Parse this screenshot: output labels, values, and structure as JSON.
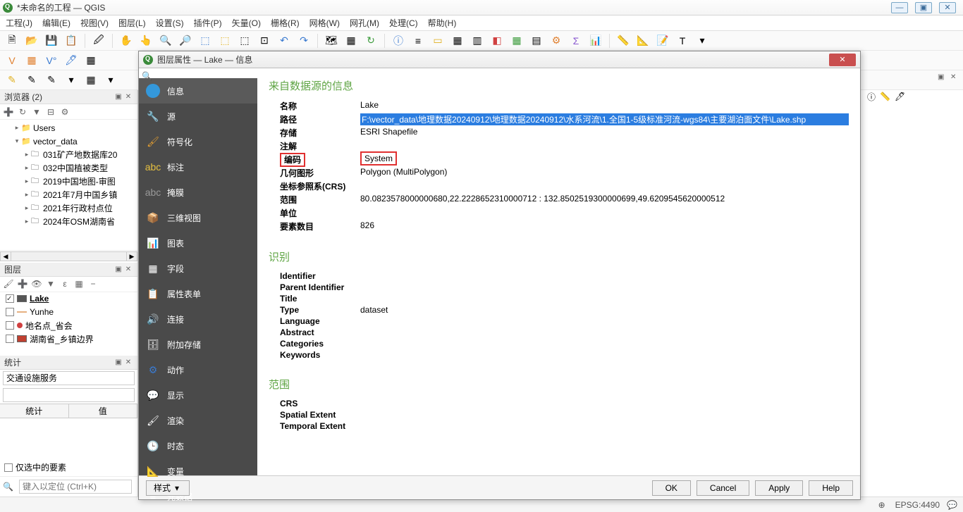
{
  "window": {
    "title": "*未命名的工程 — QGIS"
  },
  "menus": [
    "工程(J)",
    "编辑(E)",
    "视图(V)",
    "图层(L)",
    "设置(S)",
    "插件(P)",
    "矢量(O)",
    "栅格(R)",
    "网格(W)",
    "网孔(M)",
    "处理(C)",
    "帮助(H)"
  ],
  "browser": {
    "title": "浏览器 (2)",
    "items": [
      {
        "indent": 1,
        "exp": "▸",
        "icon": "📁",
        "label": "Users"
      },
      {
        "indent": 1,
        "exp": "▾",
        "icon": "📁",
        "label": "vector_data"
      },
      {
        "indent": 2,
        "exp": "▸",
        "icon": "🗀",
        "label": "031矿产地数据库20"
      },
      {
        "indent": 2,
        "exp": "▸",
        "icon": "🗀",
        "label": "032中国植被类型"
      },
      {
        "indent": 2,
        "exp": "▸",
        "icon": "🗀",
        "label": "2019中国地图-审图"
      },
      {
        "indent": 2,
        "exp": "▸",
        "icon": "🗀",
        "label": "2021年7月中国乡镇"
      },
      {
        "indent": 2,
        "exp": "▸",
        "icon": "🗀",
        "label": "2021年行政村点位"
      },
      {
        "indent": 2,
        "exp": "▸",
        "icon": "🗀",
        "label": "2024年OSM湖南省"
      }
    ]
  },
  "layers": {
    "title": "图层",
    "items": [
      {
        "checked": true,
        "color": "#555",
        "label": "Lake",
        "bold": true
      },
      {
        "checked": false,
        "color": "#e6b080",
        "label": "Yunhe",
        "line": true
      },
      {
        "checked": false,
        "color": "#d04040",
        "label": "地名点_省会",
        "dot": true
      },
      {
        "checked": false,
        "color": "#c04030",
        "label": "湖南省_乡镇边界"
      }
    ]
  },
  "stats": {
    "title": "统计",
    "service": "交通设施服务",
    "th1": "统计",
    "th2": "值",
    "cb_label": "仅选中的要素",
    "search_placeholder": "键入以定位 (Ctrl+K)"
  },
  "dialog": {
    "title": "图层属性 — Lake — 信息",
    "sidebar": [
      "信息",
      "源",
      "符号化",
      "标注",
      "掩膜",
      "三维视图",
      "图表",
      "字段",
      "属性表单",
      "连接",
      "附加存储",
      "动作",
      "显示",
      "渲染",
      "时态",
      "变量",
      "元数据"
    ],
    "section1": "来自数据源的信息",
    "rows1": [
      {
        "k": "名称",
        "v": "Lake"
      },
      {
        "k": "路径",
        "v": "F:\\vector_data\\地理数据20240912\\地理数据20240912\\水系河流\\1.全国1-5级标准河流-wgs84\\主要湖泊面文件\\Lake.shp",
        "sel": true
      },
      {
        "k": "存储",
        "v": "ESRI Shapefile"
      },
      {
        "k": "注解",
        "v": ""
      },
      {
        "k": "编码",
        "v": "System",
        "red": true
      },
      {
        "k": "几何图形",
        "v": "Polygon (MultiPolygon)"
      },
      {
        "k": "坐标参照系(CRS)",
        "v": ""
      },
      {
        "k": "范围",
        "v": "80.0823578000000680,22.2228652310000712 : 132.8502519300000699,49.6209545620000512"
      },
      {
        "k": "单位",
        "v": ""
      },
      {
        "k": "要素数目",
        "v": "826"
      }
    ],
    "section2": "识别",
    "rows2": [
      {
        "k": "Identifier",
        "v": ""
      },
      {
        "k": "Parent Identifier",
        "v": ""
      },
      {
        "k": "Title",
        "v": ""
      },
      {
        "k": "Type",
        "v": "dataset"
      },
      {
        "k": "Language",
        "v": ""
      },
      {
        "k": "Abstract",
        "v": ""
      },
      {
        "k": "Categories",
        "v": ""
      },
      {
        "k": "Keywords",
        "v": ""
      }
    ],
    "section3": "范围",
    "rows3": [
      {
        "k": "CRS",
        "v": ""
      },
      {
        "k": "Spatial Extent",
        "v": ""
      },
      {
        "k": "Temporal Extent",
        "v": ""
      }
    ],
    "style_btn": "样式",
    "buttons": [
      "OK",
      "Cancel",
      "Apply",
      "Help"
    ]
  },
  "status": {
    "crs": "EPSG:4490"
  }
}
